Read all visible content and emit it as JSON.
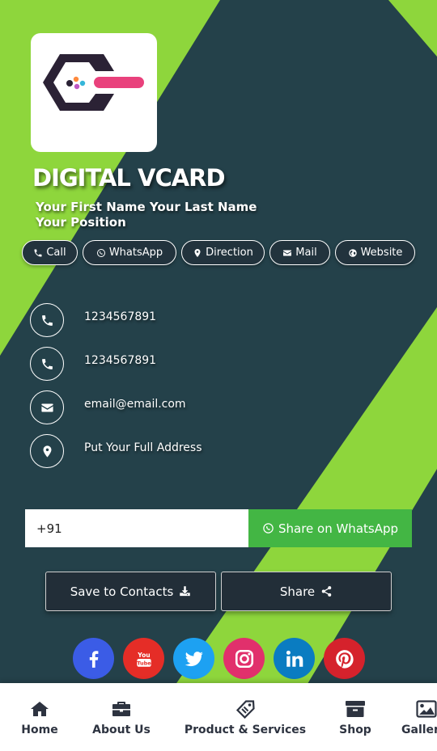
{
  "card": {
    "title": "DIGITAL VCARD",
    "name": "Your First Name Your Last Name",
    "position": "Your Position"
  },
  "quick_actions": [
    {
      "label": "Call",
      "icon": "phone-icon"
    },
    {
      "label": "WhatsApp",
      "icon": "whatsapp-icon"
    },
    {
      "label": "Direction",
      "icon": "map-marker-icon"
    },
    {
      "label": "Mail",
      "icon": "envelope-icon"
    },
    {
      "label": "Website",
      "icon": "globe-icon"
    }
  ],
  "contacts": [
    {
      "value": "1234567891",
      "icon": "phone-icon"
    },
    {
      "value": "1234567891",
      "icon": "phone-icon"
    },
    {
      "value": "email@email.com",
      "icon": "envelope-icon"
    },
    {
      "value": "Put Your Full Address",
      "icon": "map-marker-icon"
    }
  ],
  "share": {
    "input_value": "+91",
    "button_label": "Share on WhatsApp"
  },
  "buttons": {
    "save_label": "Save to Contacts",
    "share_label": "Share"
  },
  "social": [
    {
      "name": "facebook",
      "color": "#3b5ce6",
      "icon": "facebook-icon"
    },
    {
      "name": "youtube",
      "color": "#e52d27",
      "icon": "youtube-icon"
    },
    {
      "name": "twitter",
      "color": "#1da1f2",
      "icon": "twitter-icon"
    },
    {
      "name": "instagram",
      "color": "#e1306c",
      "icon": "instagram-icon"
    },
    {
      "name": "linkedin",
      "color": "#0a7cc1",
      "icon": "linkedin-icon"
    },
    {
      "name": "pinterest",
      "color": "#d5222c",
      "icon": "pinterest-icon"
    }
  ],
  "nav": [
    {
      "label": "Home",
      "icon": "home-icon"
    },
    {
      "label": "About Us",
      "icon": "briefcase-icon"
    },
    {
      "label": "Product & Services",
      "icon": "tag-icon"
    },
    {
      "label": "Shop",
      "icon": "archive-box-icon"
    },
    {
      "label": "Gallery",
      "icon": "image-icon"
    }
  ],
  "colors": {
    "background_dark": "#24414a",
    "background_green": "#8ed63c",
    "whatsapp_green": "#43b644",
    "button_dark": "#222e38",
    "nav_text": "#2d3340"
  }
}
